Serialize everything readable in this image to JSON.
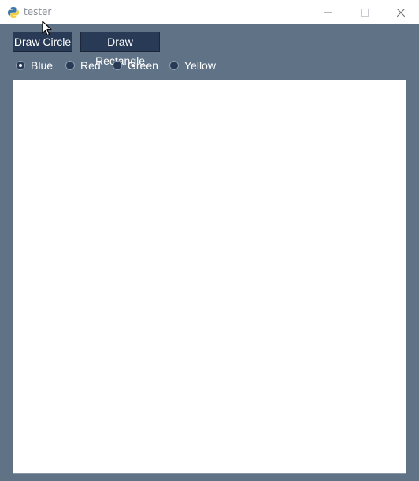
{
  "window": {
    "title": "tester",
    "icon": "python-icon",
    "controls": [
      "minimize-icon",
      "maximize-icon",
      "close-icon"
    ]
  },
  "toolbar": {
    "draw_circle_label": "Draw Circle",
    "draw_rectangle_label": "Draw Rectangle"
  },
  "colors": {
    "selected": "Blue",
    "options": [
      "Blue",
      "Red",
      "Green",
      "Yellow"
    ]
  },
  "theme": {
    "background": "#5f7286",
    "button": "#283a55",
    "canvas": "#ffffff"
  }
}
